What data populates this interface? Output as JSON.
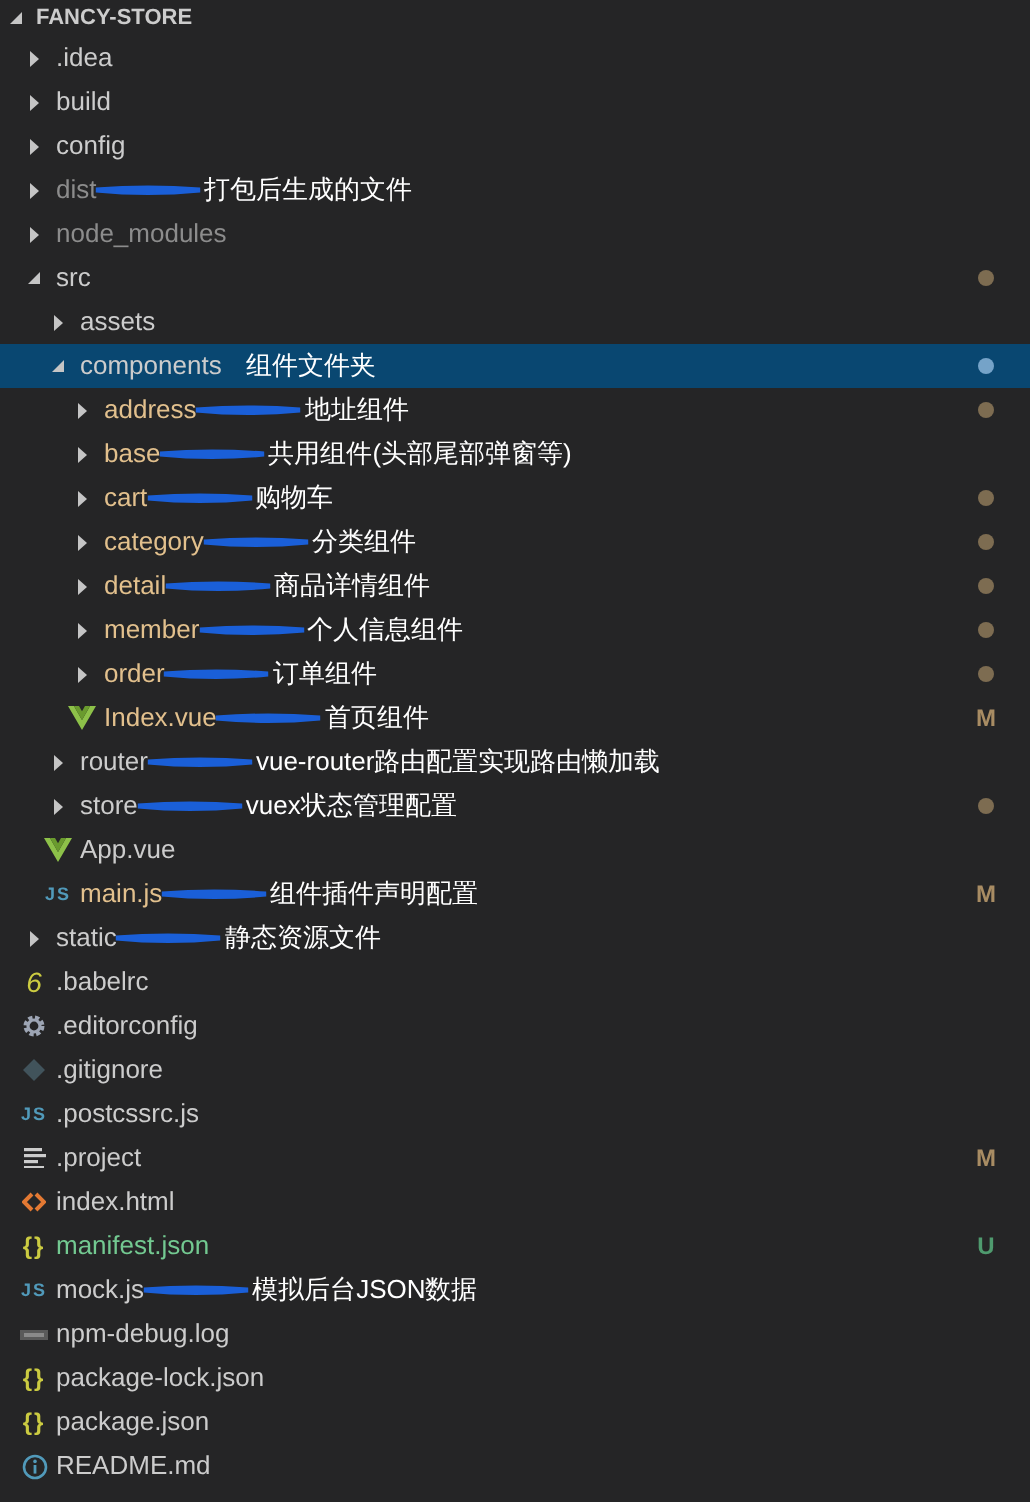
{
  "explorer": {
    "title": "FANCY-STORE",
    "expanded": true,
    "items": [
      {
        "kind": "folder",
        "name": ".idea",
        "expanded": false,
        "selected": false,
        "color": "#cccccc"
      },
      {
        "kind": "folder",
        "name": "build",
        "expanded": false,
        "selected": false,
        "color": "#cccccc"
      },
      {
        "kind": "folder",
        "name": "config",
        "expanded": false,
        "selected": false,
        "color": "#cccccc"
      },
      {
        "kind": "folder",
        "name": "dist",
        "expanded": false,
        "selected": false,
        "color": "#8c8c8c",
        "note": "打包后生成的文件"
      },
      {
        "kind": "folder",
        "name": "node_modules",
        "expanded": false,
        "selected": false,
        "color": "#8c8c8c"
      },
      {
        "kind": "folder",
        "name": "src",
        "expanded": true,
        "selected": false,
        "color": "#cccccc",
        "dot": true,
        "children": [
          {
            "kind": "folder",
            "name": "assets",
            "expanded": false,
            "selected": false,
            "color": "#cccccc"
          },
          {
            "kind": "folder",
            "name": "components",
            "expanded": true,
            "selected": true,
            "color": "#cccccc",
            "dot": true,
            "note": "组件文件夹",
            "children": [
              {
                "kind": "folder",
                "name": "address",
                "expanded": false,
                "selected": false,
                "color": "#e2c08d",
                "dot": true,
                "note": "地址组件"
              },
              {
                "kind": "folder",
                "name": "base",
                "expanded": false,
                "selected": false,
                "color": "#e2c08d",
                "note": "共用组件(头部尾部弹窗等)"
              },
              {
                "kind": "folder",
                "name": "cart",
                "expanded": false,
                "selected": false,
                "color": "#e2c08d",
                "dot": true,
                "note": "购物车"
              },
              {
                "kind": "folder",
                "name": "category",
                "expanded": false,
                "selected": false,
                "color": "#e2c08d",
                "dot": true,
                "note": "分类组件"
              },
              {
                "kind": "folder",
                "name": "detail",
                "expanded": false,
                "selected": false,
                "color": "#e2c08d",
                "dot": true,
                "note": "商品详情组件"
              },
              {
                "kind": "folder",
                "name": "member",
                "expanded": false,
                "selected": false,
                "color": "#e2c08d",
                "dot": true,
                "note": "个人信息组件"
              },
              {
                "kind": "folder",
                "name": "order",
                "expanded": false,
                "selected": false,
                "color": "#e2c08d",
                "dot": true,
                "note": "订单组件"
              },
              {
                "kind": "vue",
                "name": "Index.vue",
                "selected": false,
                "color": "#e2c08d",
                "badge": "M",
                "note": "首页组件"
              }
            ]
          },
          {
            "kind": "folder",
            "name": "router",
            "expanded": false,
            "selected": false,
            "color": "#cccccc",
            "note": "vue-router路由配置实现路由懒加载"
          },
          {
            "kind": "folder",
            "name": "store",
            "expanded": false,
            "selected": false,
            "color": "#cccccc",
            "dot": true,
            "note": "vuex状态管理配置"
          },
          {
            "kind": "vue",
            "name": "App.vue",
            "selected": false,
            "color": "#cccccc"
          },
          {
            "kind": "js",
            "icon_label": "JS",
            "name": "main.js",
            "selected": false,
            "color": "#e2c08d",
            "badge": "M",
            "note": "组件插件声明配置"
          }
        ]
      },
      {
        "kind": "folder",
        "name": "static",
        "expanded": false,
        "selected": false,
        "color": "#cccccc",
        "note": "静态资源文件"
      },
      {
        "kind": "babel",
        "icon_label": "6",
        "name": ".babelrc",
        "selected": false,
        "color": "#cccccc"
      },
      {
        "kind": "gear",
        "name": ".editorconfig",
        "selected": false,
        "color": "#cccccc"
      },
      {
        "kind": "git",
        "name": ".gitignore",
        "selected": false,
        "color": "#cccccc"
      },
      {
        "kind": "js",
        "icon_label": "JS",
        "name": ".postcssrc.js",
        "selected": false,
        "color": "#cccccc"
      },
      {
        "kind": "lines",
        "name": ".project",
        "selected": false,
        "color": "#cccccc",
        "badge": "M"
      },
      {
        "kind": "html",
        "name": "index.html",
        "selected": false,
        "color": "#cccccc"
      },
      {
        "kind": "json",
        "icon_label": "{}",
        "name": "manifest.json",
        "selected": false,
        "color": "#73c991",
        "badge": "U"
      },
      {
        "kind": "js",
        "icon_label": "JS",
        "name": "mock.js",
        "selected": false,
        "color": "#cccccc",
        "note": "模拟后台JSON数据"
      },
      {
        "kind": "npm",
        "name": "npm-debug.log",
        "selected": false,
        "color": "#cccccc"
      },
      {
        "kind": "json",
        "icon_label": "{}",
        "name": "package-lock.json",
        "selected": false,
        "color": "#cccccc"
      },
      {
        "kind": "json",
        "icon_label": "{}",
        "name": "package.json",
        "selected": false,
        "color": "#cccccc"
      },
      {
        "kind": "info",
        "name": "README.md",
        "selected": false,
        "color": "#cccccc"
      }
    ]
  }
}
